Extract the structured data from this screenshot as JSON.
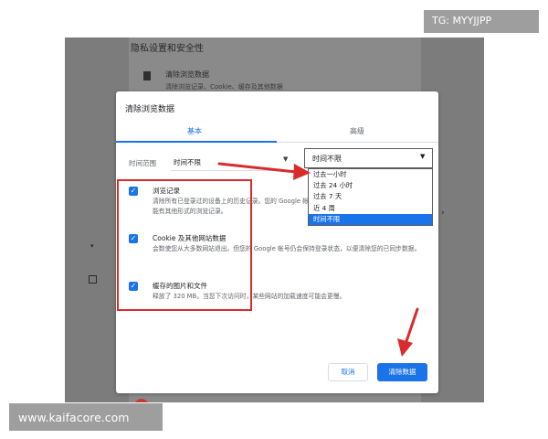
{
  "watermarks": {
    "top": "TG: MYYJJPP",
    "bottom": "www.kaifacore.com"
  },
  "background_page": {
    "section_title": "隐私设置和安全性",
    "row_title": "清除浏览数据",
    "row_desc": "清除浏览记录、Cookie、缓存及其他数据"
  },
  "dialog": {
    "title": "清除浏览数据",
    "tabs": [
      {
        "label": "基本",
        "active": true
      },
      {
        "label": "高级",
        "active": false
      }
    ],
    "time_range_label": "时间范围",
    "time_range_value": "时间不限",
    "items": [
      {
        "title": "浏览记录",
        "checked": true,
        "desc": "清除所有已登录过的设备上的历史记录。您的 Google 帐号可能会在 myactivity.google.com 上可能有其他形式的浏览记录。"
      },
      {
        "title": "Cookie 及其他网站数据",
        "checked": true,
        "desc": "会数使您从大多数网站退出。但您的 Google 帐号仍会保持登录状态，以便清除您的已同步数据。"
      },
      {
        "title": "缓存的图片和文件",
        "checked": true,
        "desc": "释放了 320 MB。当您下次访问时，某些网站的加载速度可能会更慢。"
      }
    ],
    "cancel_label": "取消",
    "clear_label": "清除数据"
  },
  "dropdown": {
    "selected": "时间不限",
    "options": [
      {
        "label": "过去一小时",
        "selected": false
      },
      {
        "label": "过去 24 小时",
        "selected": false
      },
      {
        "label": "过去 7 天",
        "selected": false
      },
      {
        "label": "近 4 周",
        "selected": false
      },
      {
        "label": "时间不限",
        "selected": true
      }
    ]
  },
  "colors": {
    "accent": "#1a73e8",
    "annotation_red": "#d92b2b",
    "overlay": "#7c7c7c"
  }
}
